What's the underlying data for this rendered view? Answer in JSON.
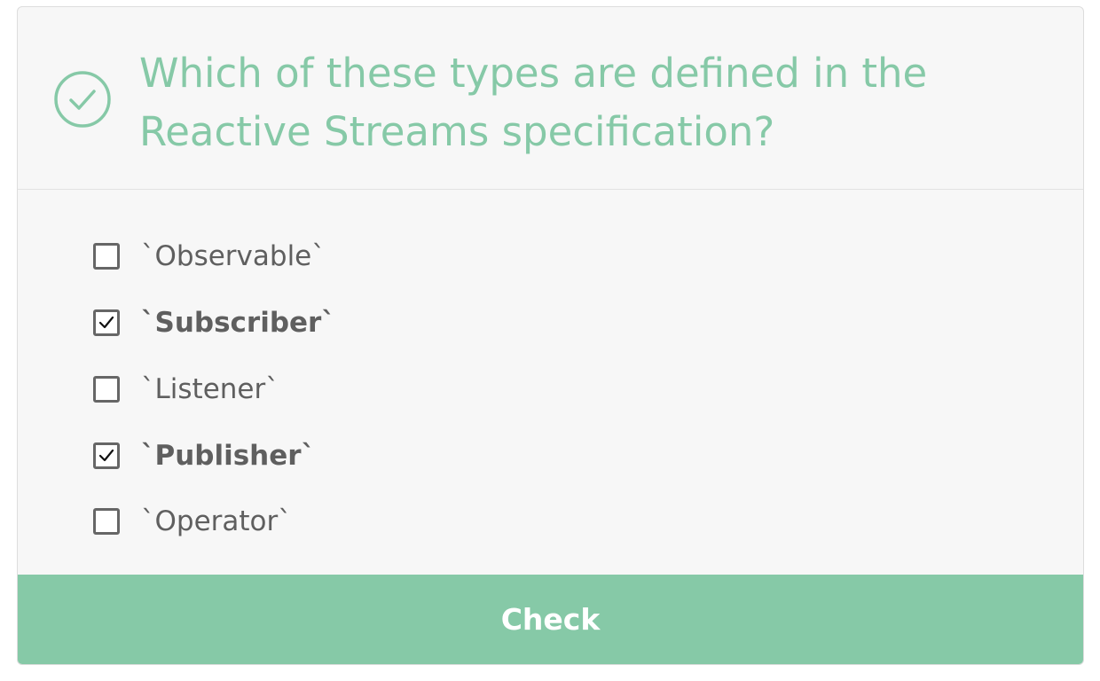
{
  "quiz": {
    "title": "Which of these types are defined in the Reactive Streams specification?",
    "icon": "check-circle-icon",
    "accent_color": "#86c9a7",
    "options": [
      {
        "label": "`Observable`",
        "checked": false
      },
      {
        "label": "`Subscriber`",
        "checked": true
      },
      {
        "label": "`Listener`",
        "checked": false
      },
      {
        "label": "`Publisher`",
        "checked": true
      },
      {
        "label": "`Operator`",
        "checked": false
      }
    ],
    "check_label": "Check"
  }
}
